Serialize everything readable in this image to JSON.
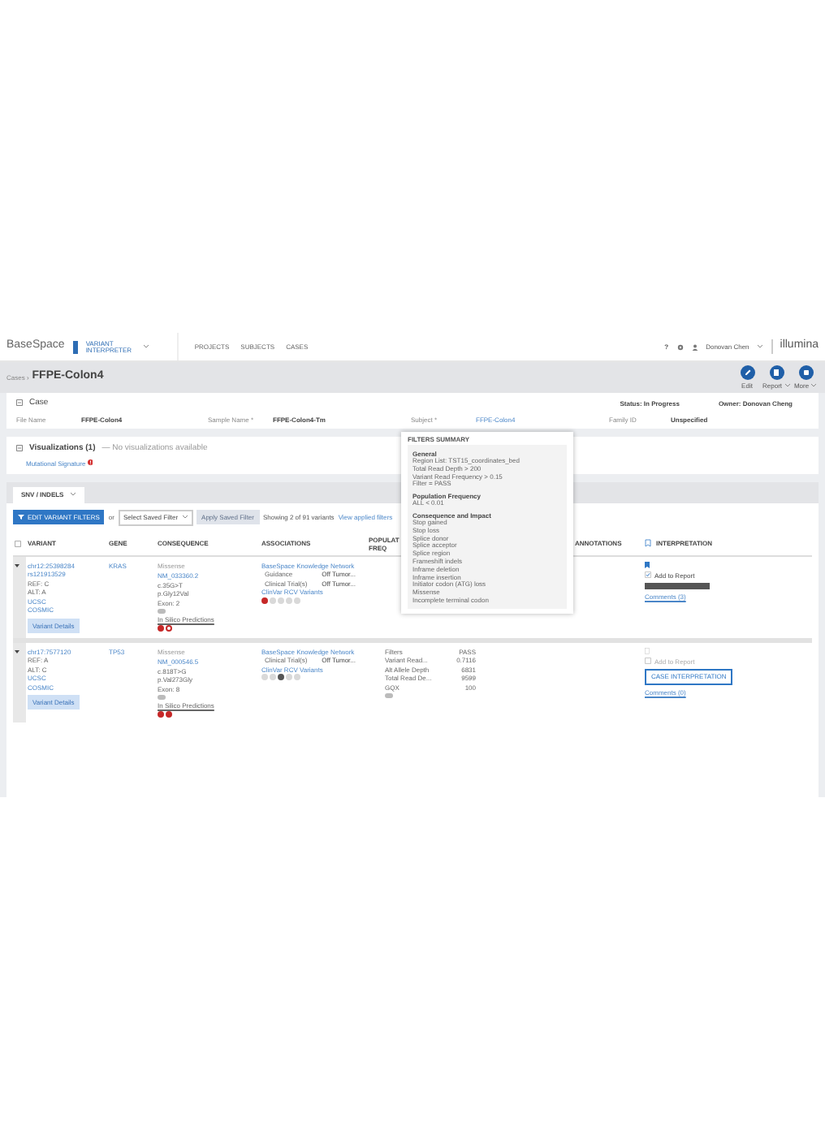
{
  "app_header": {
    "brand": "BaseSpace",
    "product": "VARIANT INTERPRETER",
    "nav": [
      "PROJECTS",
      "SUBJECTS",
      "CASES"
    ],
    "help": "?",
    "user": "Donovan Chen",
    "company": "illumina"
  },
  "title_bar": {
    "breadcrumb": "Cases ›",
    "title": "FFPE-Colon4",
    "actions": [
      {
        "label": "Edit",
        "kind": "edit",
        "has_menu": false
      },
      {
        "label": "Report",
        "kind": "report",
        "has_menu": true
      },
      {
        "label": "More",
        "kind": "more",
        "has_menu": true
      }
    ]
  },
  "case": {
    "heading": "Case",
    "status": "Status: In Progress",
    "owner": "Owner: Donovan Cheng",
    "fields": [
      {
        "label": "File Name",
        "value": "FFPE-Colon4",
        "kind": "text"
      },
      {
        "label": "Sample Name *",
        "value": "FFPE-Colon4-Tm",
        "kind": "text"
      },
      {
        "label": "Subject *",
        "value": "FFPE-Colon4",
        "kind": "link"
      },
      {
        "label": "Family ID",
        "value": "Unspecified",
        "kind": "text"
      }
    ]
  },
  "visualizations": {
    "heading": "Visualizations (1)",
    "note": "— No visualizations available",
    "link": "Mutational Signature"
  },
  "tabs": [
    {
      "label": "SNV / INDELS",
      "selected": true
    }
  ],
  "toolbar": {
    "edit_button": "EDIT VARIANT FILTERS",
    "or": "or",
    "saved_filter": "Select Saved Filter",
    "apply_button": "Apply Saved Filter",
    "apply_disabled": true,
    "count": "Showing 2 of 91 variants",
    "view_filters": "View applied filters"
  },
  "select_all": {
    "checked": false
  },
  "columns": [
    {
      "label": "VARIANT",
      "kind": "variant"
    },
    {
      "label": "GENE",
      "kind": "gene"
    },
    {
      "label": "CONSEQUENCE",
      "kind": "consequence"
    },
    {
      "label": "ASSOCIATIONS",
      "kind": "associations"
    },
    {
      "label": "POPULAT FREQ",
      "kind": "population"
    },
    {
      "label": "ANNOTATIONS",
      "kind": "annotations"
    },
    {
      "label": "INTERPRETATION",
      "kind": "interpretation"
    }
  ],
  "rows": [
    {
      "expanded": true,
      "variant": {
        "id": "chr12:25398284",
        "rsid": "rs121913529",
        "ref": "REF: C",
        "alt": "ALT: A",
        "links": [
          "UCSC",
          "COSMIC"
        ],
        "details_button": "Variant Details"
      },
      "gene": "KRAS",
      "consequence": {
        "type": "Missense",
        "transcript": "NM_033360.2",
        "cdna": "c.35G>T",
        "protein": "p.Gly12Val",
        "exon": "Exon: 2",
        "predictions_label": "In Silico Predictions",
        "predictions": [
          {
            "color": "#c62828",
            "filled": true
          },
          {
            "color": "#c62828",
            "filled": false
          }
        ]
      },
      "associations": {
        "source": "BaseSpace Knowledge Network",
        "items": [
          {
            "label": "Guidance",
            "value": "Off Tumor..."
          },
          {
            "label": "Clinical Trial(s)",
            "value": "Off Tumor..."
          }
        ],
        "clinvar_label": "ClinVar RCV Variants",
        "clinvar": [
          {
            "color": "#c62828"
          },
          {
            "color": "#d9d9d9"
          },
          {
            "color": "#d9d9d9"
          },
          {
            "color": "#d9d9d9"
          },
          {
            "color": "#d9d9d9"
          }
        ]
      },
      "quality": [],
      "interpretation": {
        "bookmarked": true,
        "add_to_report": "Add to Report",
        "checked": true,
        "kind": "interpreted",
        "comments": "Comments (3)"
      }
    },
    {
      "expanded": true,
      "variant": {
        "id": "chr17:7577120",
        "ref": "REF: A",
        "alt": "ALT: C",
        "links": [
          "UCSC",
          "COSMIC"
        ],
        "details_button": "Variant Details"
      },
      "gene": "TP53",
      "consequence": {
        "type": "Missense",
        "transcript": "NM_000546.5",
        "cdna": "c.818T>G",
        "protein": "p.Val273Gly",
        "exon": "Exon: 8",
        "predictions_label": "In Silico Predictions",
        "predictions": [
          {
            "color": "#c62828",
            "filled": true
          },
          {
            "color": "#c62828",
            "filled": true
          }
        ]
      },
      "associations": {
        "source": "BaseSpace Knowledge Network",
        "items": [
          {
            "label": "Clinical Trial(s)",
            "value": "Off Tumor..."
          }
        ],
        "clinvar_label": "ClinVar RCV Variants",
        "clinvar": [
          {
            "color": "#d9d9d9"
          },
          {
            "color": "#d9d9d9"
          },
          {
            "color": "#555555"
          },
          {
            "color": "#d9d9d9"
          },
          {
            "color": "#d9d9d9"
          }
        ]
      },
      "quality": [
        {
          "label": "Filters",
          "value": "PASS"
        },
        {
          "label": "Variant Read...",
          "value": "0.7116"
        },
        {
          "label": "Alt Allele Depth",
          "value": "6831"
        },
        {
          "label": "Total Read De...",
          "value": "9599"
        },
        {
          "label": "GQX",
          "value": "100"
        }
      ],
      "interpretation": {
        "bookmarked": false,
        "add_to_report": "Add to Report",
        "checked": false,
        "kind": "pending",
        "button": "CASE INTERPRETATION",
        "comments": "Comments (0)"
      }
    }
  ],
  "filters_summary": {
    "title": "FILTERS SUMMARY",
    "sections": [
      {
        "heading": "General",
        "items": [
          "Region List: TST15_coordinates_bed",
          "Total Read Depth > 200",
          "Variant Read Frequency > 0.15",
          "Filter = PASS"
        ]
      },
      {
        "heading": "Population Frequency",
        "items": [
          "ALL < 0.01"
        ]
      },
      {
        "heading": "Consequence and Impact",
        "items": [
          "Stop gained",
          "Stop loss",
          "Splice donor",
          "Splice acceptor",
          "Splice region",
          "Frameshift indels",
          "Inframe deletion",
          "Inframe insertion",
          "Initiator codon (ATG) loss",
          "Missense",
          "Incomplete terminal codon"
        ]
      }
    ]
  }
}
